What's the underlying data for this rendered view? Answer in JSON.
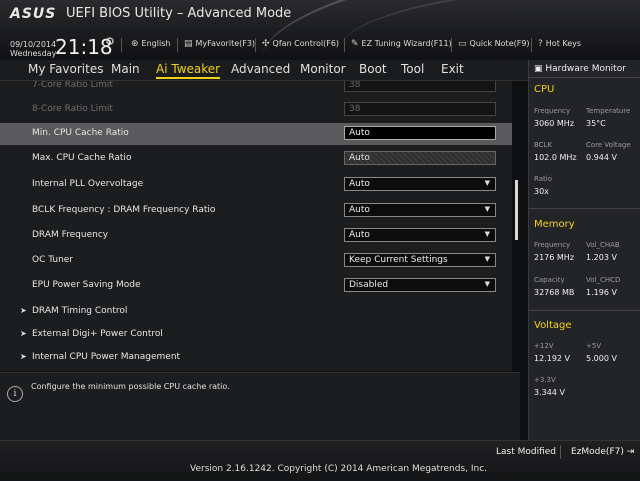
{
  "header": {
    "logo": "ASUS",
    "title": "UEFI BIOS Utility – Advanced Mode",
    "date": "09/10/2014",
    "weekday": "Wednesday",
    "time": "21:18",
    "shortcuts": [
      {
        "icon": "globe-icon",
        "label": "English"
      },
      {
        "icon": "favorite-icon",
        "label": "MyFavorite(F3)"
      },
      {
        "icon": "fan-icon",
        "label": "Qfan Control(F6)"
      },
      {
        "icon": "wizard-icon",
        "label": "EZ Tuning Wizard(F11)"
      },
      {
        "icon": "note-icon",
        "label": "Quick Note(F9)"
      },
      {
        "icon": "hotkeys-icon",
        "label": "Hot Keys"
      }
    ]
  },
  "menu": {
    "items": [
      "My Favorites",
      "Main",
      "Ai Tweaker",
      "Advanced",
      "Monitor",
      "Boot",
      "Tool",
      "Exit"
    ],
    "active": "Ai Tweaker"
  },
  "settings": [
    {
      "label": "7-Core Ratio Limit",
      "value": "38",
      "state": "disabled"
    },
    {
      "label": "8-Core Ratio Limit",
      "value": "38",
      "state": "disabled"
    },
    {
      "label": "Min. CPU Cache Ratio",
      "value": "Auto",
      "state": "selected"
    },
    {
      "label": "Max. CPU Cache Ratio",
      "value": "Auto",
      "state": "readonly"
    },
    {
      "label": "Internal PLL Overvoltage",
      "value": "Auto",
      "state": "dropdown"
    },
    {
      "label": "BCLK Frequency : DRAM Frequency Ratio",
      "value": "Auto",
      "state": "dropdown"
    },
    {
      "label": "DRAM Frequency",
      "value": "Auto",
      "state": "dropdown"
    },
    {
      "label": "OC Tuner",
      "value": "Keep Current Settings",
      "state": "dropdown"
    },
    {
      "label": "EPU Power Saving Mode",
      "value": "Disabled",
      "state": "dropdown"
    }
  ],
  "submenus": [
    "DRAM Timing Control",
    "External Digi+ Power Control",
    "Internal CPU Power Management"
  ],
  "help": {
    "text": "Configure the minimum possible CPU cache ratio."
  },
  "hwmon": {
    "title": "Hardware Monitor",
    "cpu": {
      "heading": "CPU",
      "frequency_label": "Frequency",
      "frequency": "3060 MHz",
      "temperature_label": "Temperature",
      "temperature": "35°C",
      "bclk_label": "BCLK",
      "bclk": "102.0 MHz",
      "core_voltage_label": "Core Voltage",
      "core_voltage": "0.944 V",
      "ratio_label": "Ratio",
      "ratio": "30x"
    },
    "memory": {
      "heading": "Memory",
      "frequency_label": "Frequency",
      "frequency": "2176 MHz",
      "vol_chab_label": "Vol_CHAB",
      "vol_chab": "1.203 V",
      "capacity_label": "Capacity",
      "capacity": "32768 MB",
      "vol_chcd_label": "Vol_CHCD",
      "vol_chcd": "1.196 V"
    },
    "voltage": {
      "heading": "Voltage",
      "v12_label": "+12V",
      "v12": "12.192 V",
      "v5_label": "+5V",
      "v5": "5.000 V",
      "v33_label": "+3.3V",
      "v33": "3.344 V"
    }
  },
  "footer": {
    "last_modified": "Last Modified",
    "ezmode": "EzMode(F7)",
    "version": "Version 2.16.1242. Copyright (C) 2014 American Megatrends, Inc."
  },
  "colors": {
    "accent": "#f2d214",
    "selected_row": "#5a5a5c"
  }
}
